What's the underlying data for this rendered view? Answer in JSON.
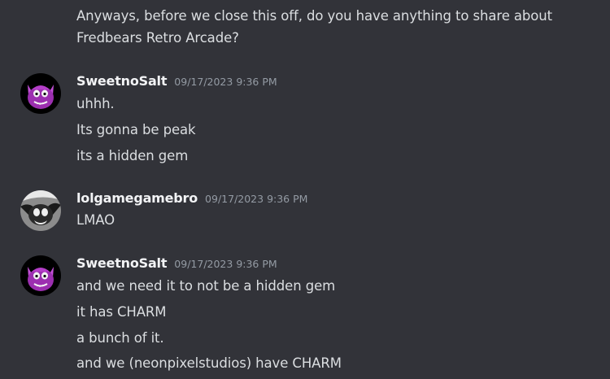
{
  "top_message": {
    "lines": [
      "Anyways, before we close this off, do you have anything to share about",
      "Fredbears Retro Arcade?"
    ]
  },
  "messages": [
    {
      "username": "SweetnoSalt",
      "timestamp": "09/17/2023 9:36 PM",
      "avatar_icon": "purple-creature-avatar",
      "lines": [
        "uhhh.",
        "Its gonna be peak",
        "its a hidden gem"
      ]
    },
    {
      "username": "lolgamegamebro",
      "timestamp": "09/17/2023 9:36 PM",
      "avatar_icon": "grey-swirl-creature-avatar",
      "lines": [
        "LMAO"
      ]
    },
    {
      "username": "SweetnoSalt",
      "timestamp": "09/17/2023 9:36 PM",
      "avatar_icon": "purple-creature-avatar",
      "lines": [
        "and we need it to not be a hidden gem",
        "it has CHARM",
        "a bunch of it.",
        "and we (neonpixelstudios) have CHARM"
      ]
    }
  ],
  "colors": {
    "background": "#323339",
    "message_text": "#dbdee1",
    "username": "#f2f3f5",
    "timestamp": "#949ba4"
  }
}
